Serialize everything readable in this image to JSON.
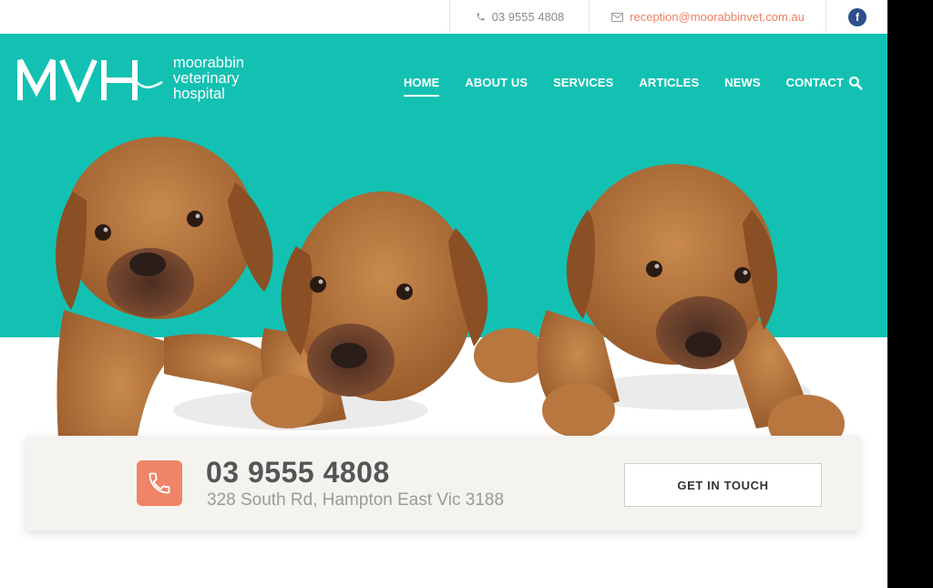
{
  "topbar": {
    "phone": "03 9555 4808",
    "email": "reception@moorabbinvet.com.au",
    "social_icon": "facebook-icon",
    "facebook_letter": "f"
  },
  "logo": {
    "mark": "MVH",
    "line1": "moorabbin",
    "line2": "veterinary",
    "line3": "hospital"
  },
  "nav": {
    "items": [
      {
        "label": "HOME",
        "active": true
      },
      {
        "label": "ABOUT US"
      },
      {
        "label": "SERVICES"
      },
      {
        "label": "ARTICLES"
      },
      {
        "label": "NEWS"
      },
      {
        "label": "CONTACT"
      }
    ],
    "search_icon": "search-icon"
  },
  "hero": {
    "image": "three-puppies"
  },
  "contact_strip": {
    "phone": "03 9555 4808",
    "address": "328 South Rd, Hampton East Vic 3188",
    "cta_label": "GET IN TOUCH",
    "icon": "phone-icon"
  },
  "colors": {
    "teal": "#13c1b2",
    "coral": "#ef8468",
    "facebook": "#2d4f8c",
    "strip_bg": "#f5f3ef"
  }
}
